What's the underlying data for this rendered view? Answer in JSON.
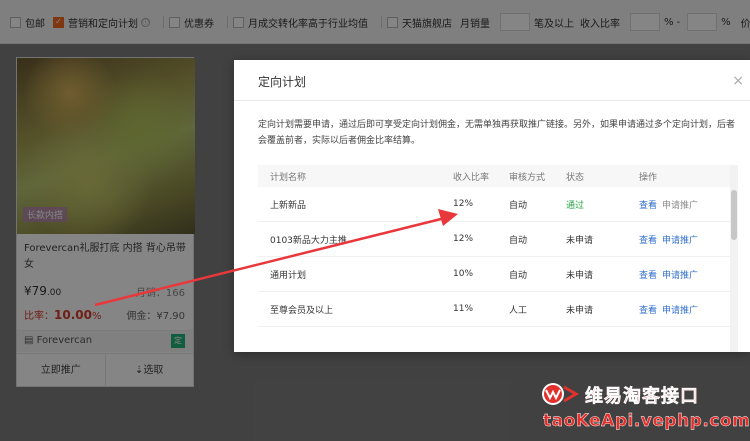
{
  "filters": {
    "baoyou": "包邮",
    "yingxiao": "营销和定向计划",
    "info_icon": "ⓘ",
    "youhuiquan": "优惠券",
    "conversion": "月成交转化率高于行业均值",
    "tmall": "天猫旗舰店",
    "monthly_sales_label": "月销量",
    "monthly_sales_suffix": "笔及以上",
    "income_label": "收入比率",
    "pct1": "%",
    "dash": "-",
    "pct2": "%",
    "price_label": "价格"
  },
  "product": {
    "image_tag": "长款内搭",
    "name": "Forevercan礼服打底 内搭 背心吊带女",
    "price_symbol": "¥",
    "price_main": "79",
    "price_dec": ".00",
    "sales_label": "月销：",
    "sales_value": "166",
    "rate_label": "比率：",
    "rate_value": "10.00",
    "rate_unit": "%",
    "commission_label": "佣金：",
    "commission_value": "¥7.90",
    "shop_icon": "store-icon",
    "shop": "Forevercan",
    "badge": "定",
    "promote_button": "立即推广",
    "select_button": "选取"
  },
  "modal": {
    "title": "定向计划",
    "close": "×",
    "description": "定向计划需要申请，通过后即可享受定向计划佣金，无需单独再获取推广链接。另外，如果申请通过多个定向计划，后者会覆盖前者，实际以后者佣金比率结算。",
    "headers": [
      "计划名称",
      "收入比率",
      "审核方式",
      "状态",
      "操作"
    ],
    "rows": [
      {
        "name": "上新新品",
        "rate": "12%",
        "review": "自动",
        "status": "通过",
        "view": "查看",
        "apply": "申请推广"
      },
      {
        "name": "0103新品大力主推",
        "rate": "12%",
        "review": "自动",
        "status": "未申请",
        "view": "查看",
        "apply": "申请推广"
      },
      {
        "name": "通用计划",
        "rate": "10%",
        "review": "自动",
        "status": "未申请",
        "view": "查看",
        "apply": "申请推广"
      },
      {
        "name": "至尊会员及以上",
        "rate": "11%",
        "review": "人工",
        "status": "未申请",
        "view": "查看",
        "apply": "申请推广"
      }
    ]
  },
  "watermark": {
    "title": "维易淘客接口",
    "url": "taoKeApi.vephp.com"
  },
  "colors": {
    "accent": "#f36a22",
    "rate_red": "#d63c2c",
    "link_blue": "#2f6ecd",
    "pass_green": "#28a745",
    "arrow_red": "#e8383b"
  }
}
